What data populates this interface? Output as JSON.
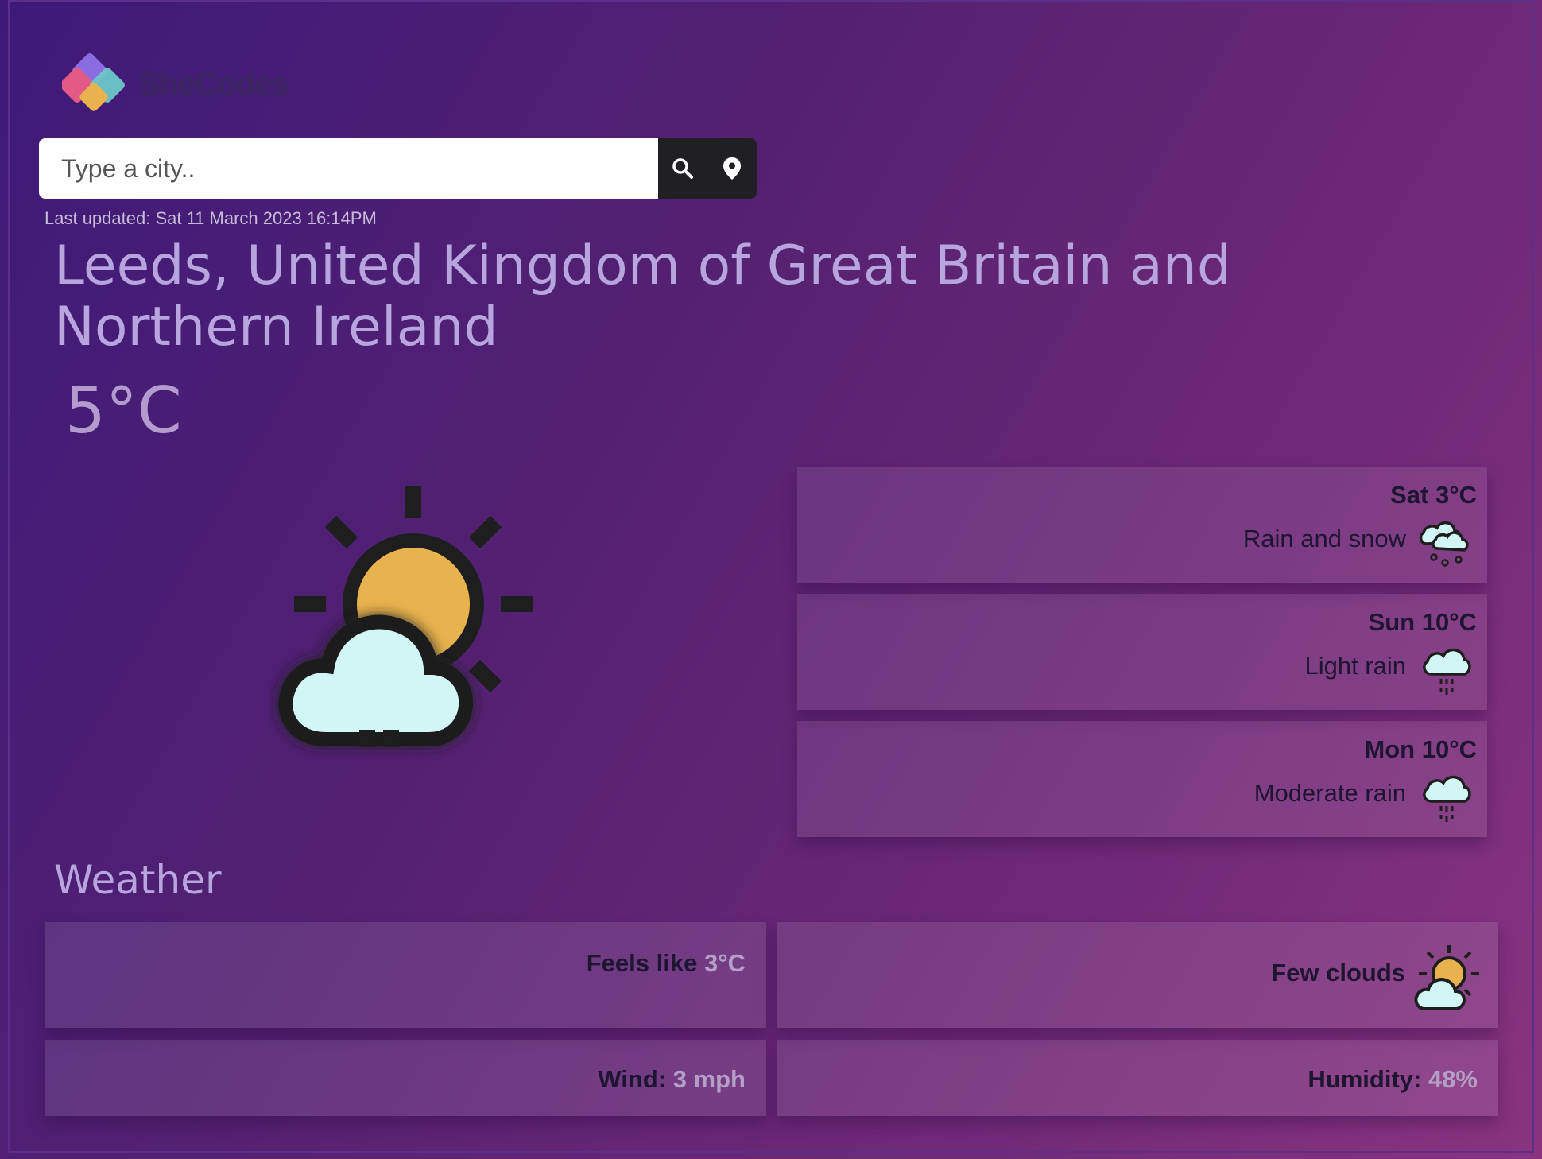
{
  "brand": {
    "name": "SheCodes"
  },
  "search": {
    "placeholder": "Type a city.."
  },
  "icons": {
    "search": "search-icon",
    "location": "location-pin-icon"
  },
  "updated": {
    "text": "Last updated: Sat 11 March 2023 16:14PM"
  },
  "current": {
    "city": "Leeds, United Kingdom of Great Britain and Northern Ireland",
    "temperature": "5°C",
    "icon": "few-clouds-icon"
  },
  "forecast": [
    {
      "day": "Sat 3°C",
      "description": "Rain and snow",
      "icon": "rain-snow-icon"
    },
    {
      "day": "Sun 10°C",
      "description": "Light rain",
      "icon": "light-rain-icon"
    },
    {
      "day": "Mon 10°C",
      "description": "Moderate rain",
      "icon": "moderate-rain-icon"
    }
  ],
  "details": {
    "heading": "Weather",
    "feels_like_label": "Feels like",
    "feels_like_value": "3°C",
    "condition": "Few clouds",
    "wind_label": "Wind:",
    "wind_value": "3 mph",
    "humidity_label": "Humidity:",
    "humidity_value": "48%"
  },
  "colors": {
    "sun": "#e8b24e",
    "cloud": "#d2f6f6",
    "outline": "#1e1e1e"
  }
}
